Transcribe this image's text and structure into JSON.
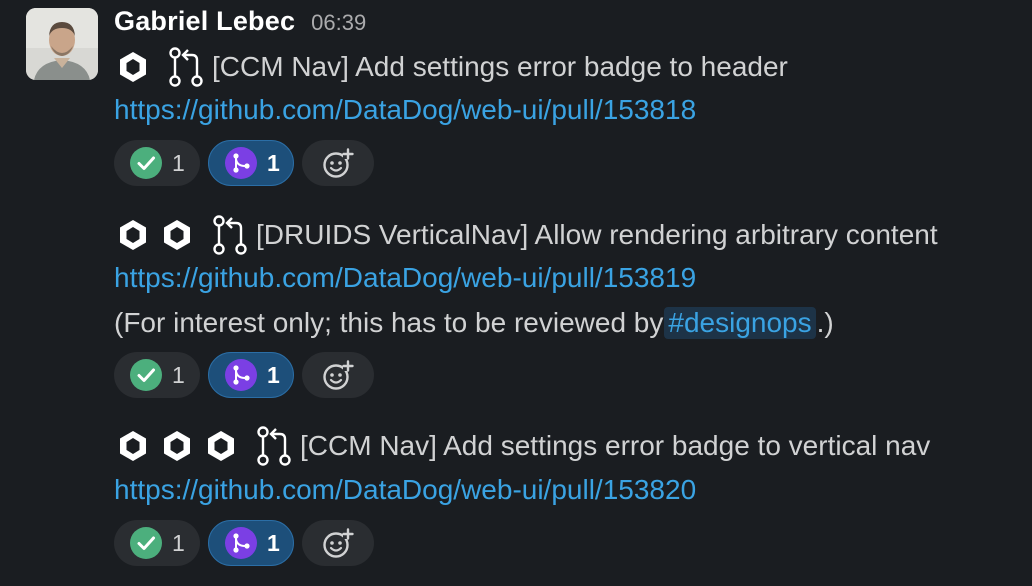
{
  "author": {
    "name": "Gabriel Lebec",
    "time": "06:39"
  },
  "posts": [
    {
      "title": "[CCM Nav] Add settings error badge to header",
      "link": "https://github.com/DataDog/web-ui/pull/153818",
      "reactions": {
        "check_count": "1",
        "merge_count": "1"
      }
    },
    {
      "title": "[DRUIDS VerticalNav] Allow rendering arbitrary content",
      "link": "https://github.com/DataDog/web-ui/pull/153819",
      "note_prefix": "(For interest only; this has to be reviewed by ",
      "note_channel": "#designops",
      "note_suffix": ".)",
      "reactions": {
        "check_count": "1",
        "merge_count": "1"
      }
    },
    {
      "title": "[CCM Nav] Add settings error badge to vertical nav",
      "link": "https://github.com/DataDog/web-ui/pull/153820",
      "reactions": {
        "check_count": "1",
        "merge_count": "1"
      }
    }
  ],
  "icons": {
    "hexagon": "hexagon-nut-icon",
    "pull_request": "pull-request-icon",
    "check": "white-check-mark-icon",
    "merge": "merged-icon",
    "add_reaction": "add-reaction-icon"
  },
  "colors": {
    "background": "#1a1d21",
    "link": "#3aa3e3",
    "check_green": "#4caf7d",
    "merge_purple": "#7b3fe4",
    "merge_pill": "#1d4f7a"
  }
}
